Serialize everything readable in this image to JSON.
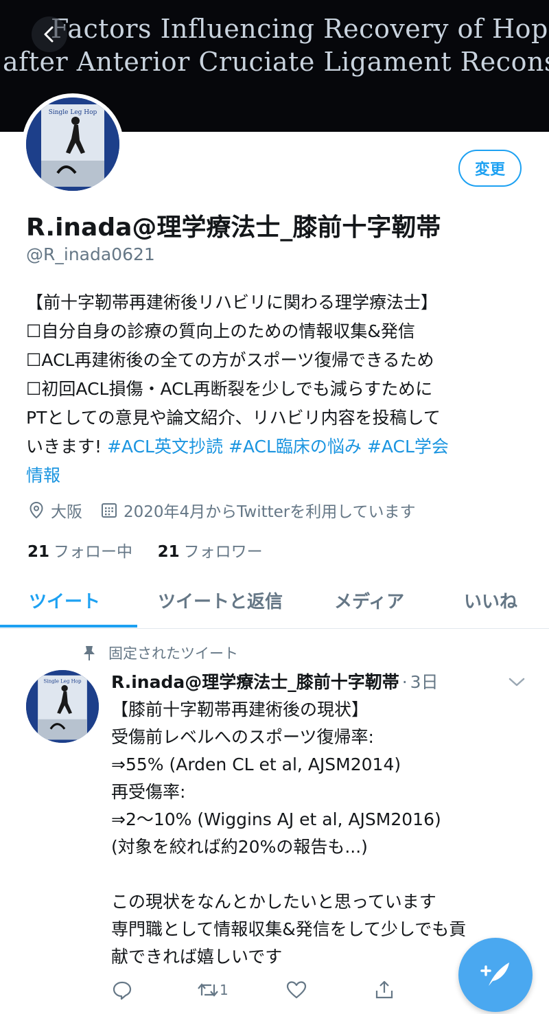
{
  "banner": {
    "line1": "Factors Influencing Recovery of Hop Tests",
    "line2": "after Anterior Cruciate Ligament Reconstructio"
  },
  "avatar": {
    "label": "Single Leg Hop"
  },
  "profile": {
    "edit_label": "変更",
    "display_name": "R.inada@理学療法士_膝前十字靭帯",
    "handle": "@R_inada0621",
    "bio": {
      "line1": "【前十字靭帯再建術後リハビリに関わる理学療法士】",
      "line2": "☐自分自身の診療の質向上のための情報収集&発信",
      "line3": "☐ACL再建術後の全ての方がスポーツ復帰できるため",
      "line4": "☐初回ACL損傷・ACL再断裂を少しでも減らすために",
      "line5": "PTとしての意見や論文紹介、リハビリ内容を投稿して",
      "line6_text": "いきます!",
      "hashtag1": "#ACL英文抄読",
      "hashtag2": "#ACL臨床の悩み",
      "hashtag3": "#ACL学会",
      "hashtag3_cont": "情報"
    },
    "location": "大阪",
    "joined": "2020年4月からTwitterを利用しています",
    "following_count": "21",
    "following_label": "フォロー中",
    "followers_count": "21",
    "followers_label": "フォロワー"
  },
  "tabs": [
    "ツイート",
    "ツイートと返信",
    "メディア",
    "いいね"
  ],
  "pinned_tweet": {
    "pinned_label": "固定されたツイート",
    "author": "R.inada@理学療法士_膝前十字靭帯",
    "dot": "·",
    "time": "3日",
    "lines": [
      "【膝前十字靭帯再建術後の現状】",
      "受傷前レベルへのスポーツ復帰率:",
      "⇒55%  (Arden CL et al, AJSM2014)",
      "再受傷率:",
      "⇒2〜10% (Wiggins AJ et al, AJSM2016)",
      "(対象を絞れば約20%の報告も...)",
      "",
      "この現状をなんとかしたいと思っています",
      "専門職として情報収集&発信をして少しでも貢",
      "献できれば嬉しいです"
    ],
    "retweet_count": "1"
  },
  "colors": {
    "accent": "#1da1f2",
    "muted": "#657786",
    "text": "#14171a"
  },
  "icons": [
    "back-arrow-icon",
    "location-pin-icon",
    "calendar-icon",
    "pin-icon",
    "chevron-down-icon",
    "reply-icon",
    "retweet-icon",
    "like-icon",
    "share-icon",
    "compose-tweet-icon"
  ]
}
